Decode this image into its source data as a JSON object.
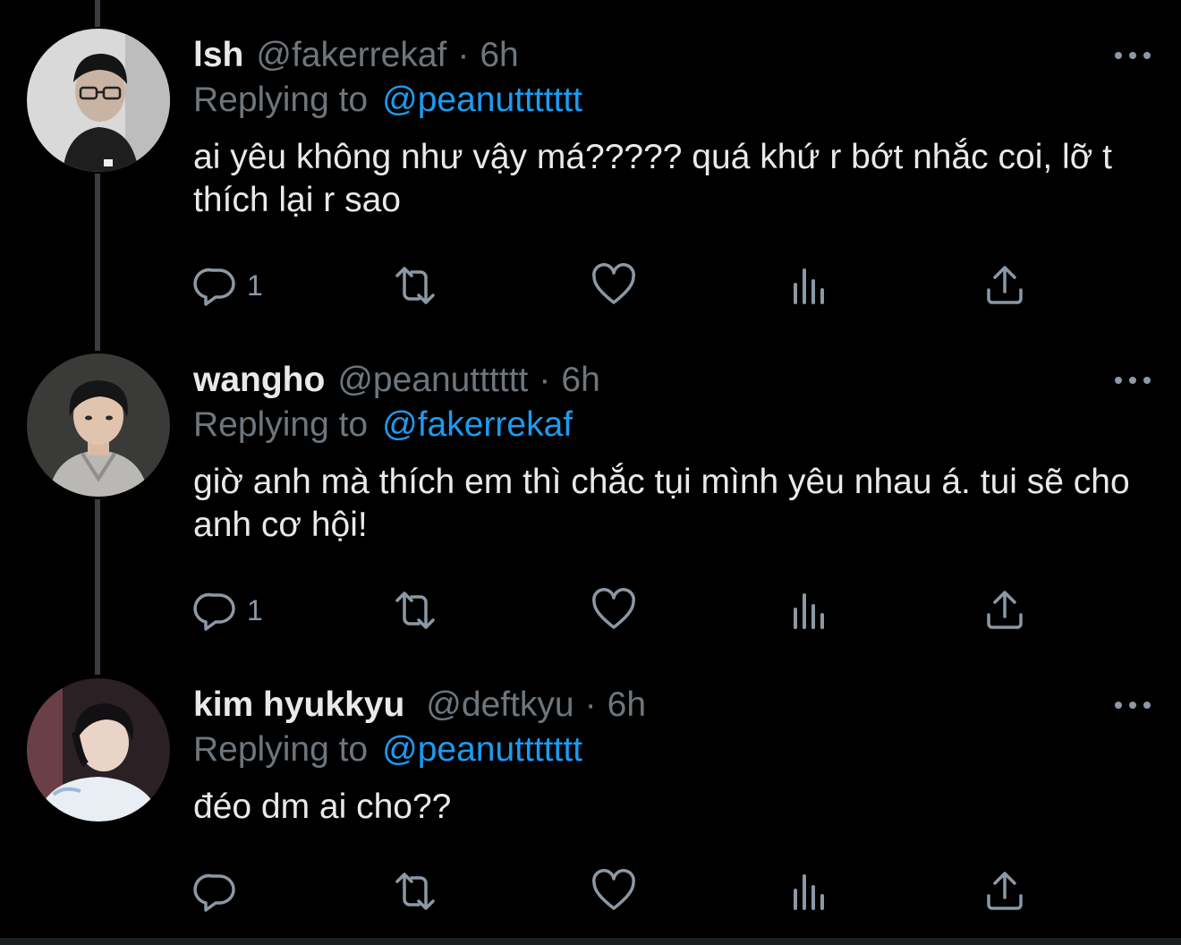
{
  "colors": {
    "background": "#000000",
    "text": "#e7e9ea",
    "muted": "#6e767d",
    "link": "#1d9bf0",
    "icon": "#8b98a5",
    "thread_line": "#3a3d41"
  },
  "tweets": [
    {
      "name": "lsh",
      "handle": "@fakerrekaf",
      "separator": "·",
      "time": "6h",
      "replying_label": "Replying to",
      "replying_to": "@peanuttttttt",
      "text": "ai yêu không như vậy má????? quá khứ r bớt nhắc coi, lỡ t thích lại r sao",
      "reply_count": "1",
      "icons": [
        "reply-icon",
        "retweet-icon",
        "like-icon",
        "analytics-icon",
        "share-icon",
        "more-icon"
      ]
    },
    {
      "name": "wangho",
      "handle": "@peanutttttt",
      "separator": "·",
      "time": "6h",
      "replying_label": "Replying to",
      "replying_to": "@fakerrekaf",
      "text": "giờ anh mà thích em thì chắc tụi mình yêu nhau á. tui sẽ cho anh cơ hội!",
      "reply_count": "1",
      "icons": [
        "reply-icon",
        "retweet-icon",
        "like-icon",
        "analytics-icon",
        "share-icon",
        "more-icon"
      ]
    },
    {
      "name": "kim hyukkyu",
      "handle": "@deftkyu",
      "separator": "·",
      "time": "6h",
      "replying_label": "Replying to",
      "replying_to": "@peanuttttttt",
      "text": "đéo dm ai cho??",
      "reply_count": "",
      "icons": [
        "reply-icon",
        "retweet-icon",
        "like-icon",
        "analytics-icon",
        "share-icon",
        "more-icon"
      ]
    }
  ]
}
